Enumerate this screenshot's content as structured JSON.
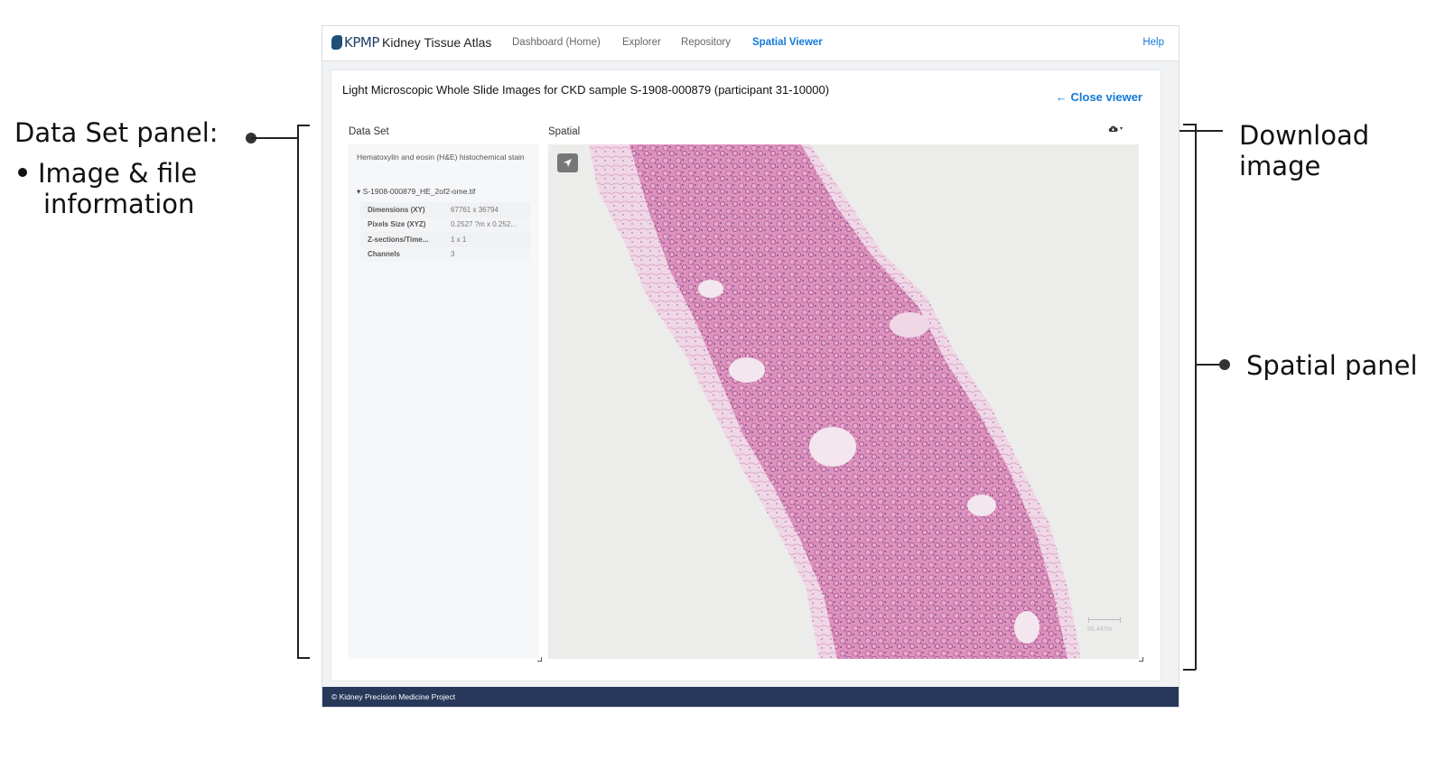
{
  "annotations": {
    "left_title": "Data Set panel:",
    "left_bullet_line1": "Image & file",
    "left_bullet_line2": "information",
    "right_download_line1": "Download",
    "right_download_line2": "image",
    "right_spatial": "Spatial panel"
  },
  "navbar": {
    "logo": "KPMP",
    "brand": "Kidney Tissue Atlas",
    "items": [
      "Dashboard (Home)",
      "Explorer",
      "Repository",
      "Spatial Viewer"
    ],
    "active": "Spatial Viewer",
    "help": "Help"
  },
  "viewer": {
    "title": "Light Microscopic Whole Slide Images for CKD sample S-1908-000879 (participant 31-10000)",
    "close_label": "Close viewer",
    "dataset_label": "Data Set",
    "spatial_label": "Spatial",
    "stain": "Hematoxylin and eosin (H&E) histochemical stain",
    "file_name": "S-1908-000879_HE_2of2-ome.tif",
    "metadata": [
      {
        "key": "Dimensions (XY)",
        "value": "67761 x 36794"
      },
      {
        "key": "Pixels Size (XYZ)",
        "value": "0.2527 ?m x 0.252..."
      },
      {
        "key": "Z-sections/Time...",
        "value": "1 x 1"
      },
      {
        "key": "Channels",
        "value": "3"
      }
    ],
    "scale_label": "95.44?m"
  },
  "colors": {
    "accent": "#1479d6",
    "footer_bg": "#27385a",
    "tissue": "#d98fb8"
  },
  "footer": "© Kidney Precision Medicine Project"
}
